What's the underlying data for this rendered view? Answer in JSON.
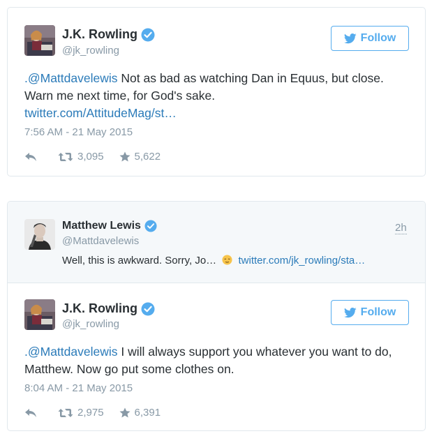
{
  "tweet1": {
    "name": "J.K. Rowling",
    "handle": "@jk_rowling",
    "follow_label": "Follow",
    "mention": ".@Mattdavelewis",
    "text": " Not as bad as watching Dan in Equus, but close. Warn me next time, for God's sake.",
    "link": "twitter.com/AttitudeMag/st…",
    "timestamp": "7:56 AM - 21 May 2015",
    "retweets": "3,095",
    "favorites": "5,622"
  },
  "quoted": {
    "name": "Matthew Lewis",
    "handle": "@Mattdavelewis",
    "time": "2h",
    "text": "Well, this is awkward. Sorry, Jo…",
    "link": "twitter.com/jk_rowling/sta…"
  },
  "tweet2": {
    "name": "J.K. Rowling",
    "handle": "@jk_rowling",
    "follow_label": "Follow",
    "mention": ".@Mattdavelewis",
    "text": " I will always support you whatever you want to do, Matthew.  Now go put some clothes on.",
    "timestamp": "8:04 AM - 21 May 2015",
    "retweets": "2,975",
    "favorites": "6,391"
  },
  "colors": {
    "accent": "#55acee",
    "link": "#2b7bb9",
    "muted": "#8899a6",
    "border": "#e1e8ed"
  }
}
